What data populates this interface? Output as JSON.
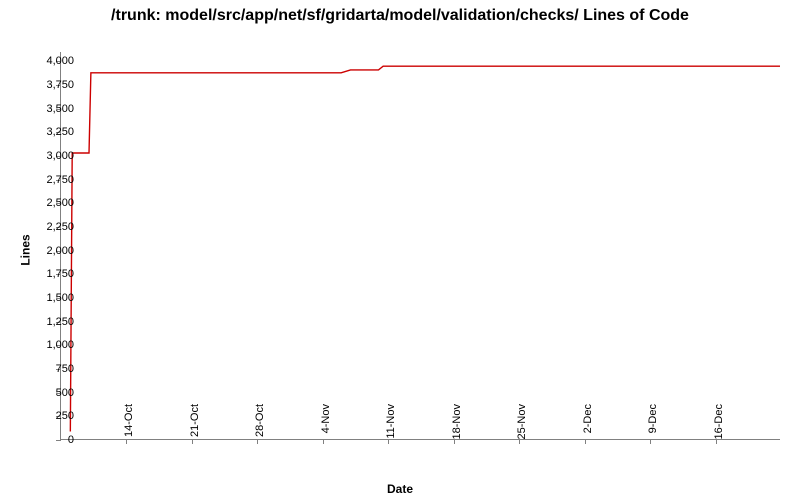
{
  "chart_data": {
    "type": "line",
    "title": "/trunk: model/src/app/net/sf/gridarta/model/validation/checks/ Lines of Code",
    "xlabel": "Date",
    "ylabel": "Lines",
    "ylim": [
      0,
      4100
    ],
    "y_ticks": [
      0,
      250,
      500,
      750,
      1000,
      1250,
      1500,
      1750,
      2000,
      2250,
      2500,
      2750,
      3000,
      3250,
      3500,
      3750,
      4000
    ],
    "x_categories": [
      "14-Oct",
      "21-Oct",
      "28-Oct",
      "4-Nov",
      "11-Nov",
      "18-Nov",
      "25-Nov",
      "2-Dec",
      "9-Dec",
      "16-Dec"
    ],
    "x_range": [
      0,
      77
    ],
    "x_tick_positions": [
      7,
      14,
      21,
      28,
      35,
      42,
      49,
      56,
      63,
      70
    ],
    "series": [
      {
        "name": "Lines of Code",
        "color": "#cc0000",
        "points": [
          {
            "x": 1,
            "y": 80
          },
          {
            "x": 1.2,
            "y": 3030
          },
          {
            "x": 3,
            "y": 3030
          },
          {
            "x": 3.2,
            "y": 3880
          },
          {
            "x": 30,
            "y": 3880
          },
          {
            "x": 31,
            "y": 3910
          },
          {
            "x": 34,
            "y": 3910
          },
          {
            "x": 34.5,
            "y": 3950
          },
          {
            "x": 77,
            "y": 3950
          }
        ]
      }
    ]
  }
}
